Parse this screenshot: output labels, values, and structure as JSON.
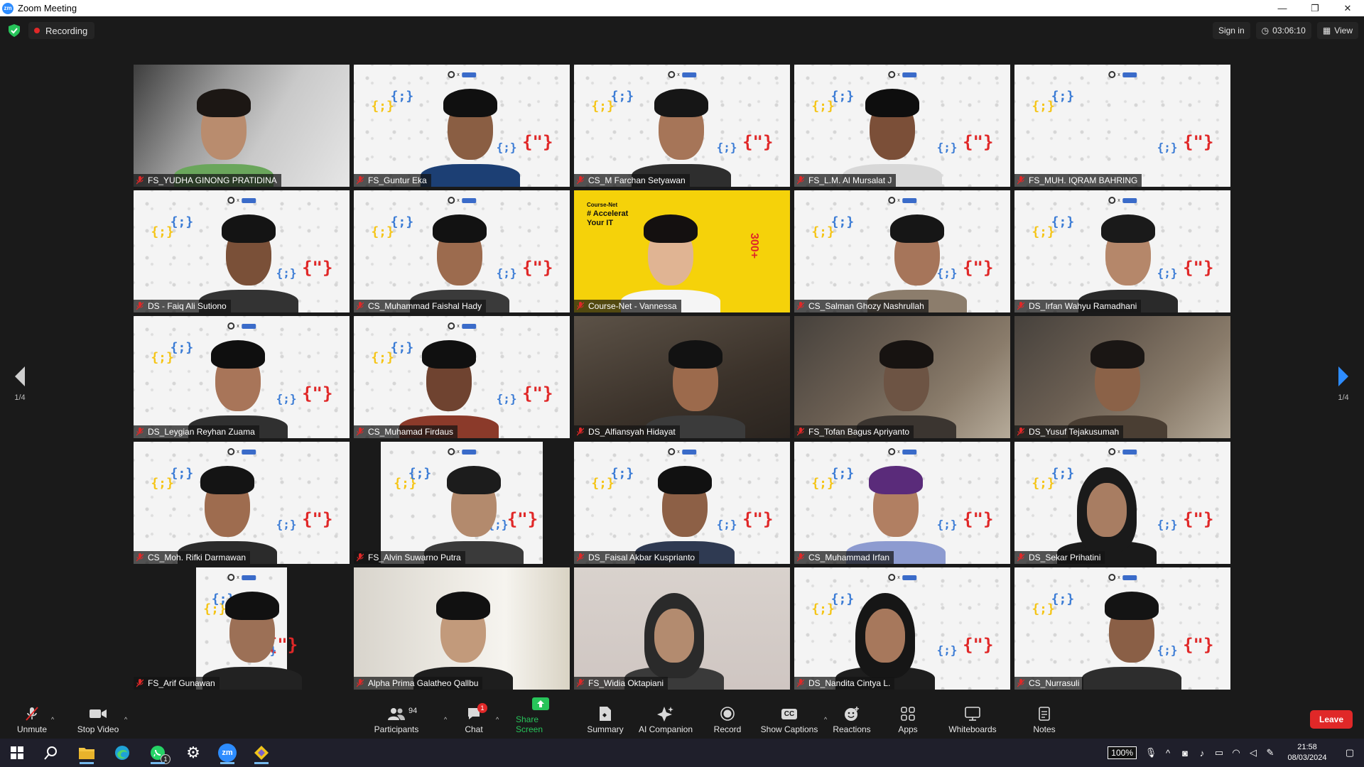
{
  "window": {
    "title": "Zoom Meeting",
    "app_icon_text": "zm",
    "minimize": "—",
    "restore": "❐",
    "close": "✕"
  },
  "meeting_bar": {
    "recording_label": "Recording",
    "sign_in": "Sign in",
    "timer": "03:06:10",
    "view_label": "View"
  },
  "pager": {
    "left_text": "1/4",
    "right_text": "1/4"
  },
  "participants": [
    {
      "name": "FS_YUDHA GINONG PRATIDINA",
      "bg": "grayroom",
      "skin": "#b98c6e",
      "hair": "#1c1714",
      "shirt": "#6aa65b"
    },
    {
      "name": "FS_Guntur Eka",
      "bg": "pattern",
      "skin": "#8a5e43",
      "hair": "#101010",
      "shirt": "#1c3f74"
    },
    {
      "name": "CS_M Farchan Setyawan",
      "bg": "pattern",
      "skin": "#a67558",
      "hair": "#161616",
      "shirt": "#2e2e2e"
    },
    {
      "name": "FS_L.M. Al Mursalat J",
      "bg": "pattern",
      "skin": "#7b4f38",
      "hair": "#0e0e0e",
      "shirt": "#d8d8d8"
    },
    {
      "name": "FS_MUH. IQRAM BAHRING",
      "bg": "pattern",
      "skin": "#000000",
      "hair": "#000000",
      "shirt": "#000000",
      "empty": true
    },
    {
      "name": "DS - Faiq Ali Sutiono",
      "bg": "pattern",
      "skin": "#7a5038",
      "hair": "#141414",
      "shirt": "#333333"
    },
    {
      "name": "CS_Muhammad Faishal Hady",
      "bg": "pattern",
      "skin": "#9c6b4e",
      "hair": "#121212",
      "shirt": "#3a3a3a"
    },
    {
      "name": "Course-Net - Vannessa",
      "bg": "yellow",
      "skin": "#e0b493",
      "hair": "#141010",
      "shirt": "#f5f5f5",
      "speaking": true
    },
    {
      "name": "CS_Salman Ghozy Nashrullah",
      "bg": "pattern",
      "skin": "#a6755a",
      "hair": "#161616",
      "shirt": "#8c7d6c"
    },
    {
      "name": "DS_Irfan Wahyu Ramadhani",
      "bg": "pattern",
      "skin": "#b5876a",
      "hair": "#1a1a1a",
      "shirt": "#2a2a2a"
    },
    {
      "name": "DS_Leygian Reyhan Zuama",
      "bg": "pattern",
      "skin": "#a87559",
      "hair": "#0f0f0f",
      "shirt": "#303030"
    },
    {
      "name": "CS_Muhamad Firdaus",
      "bg": "pattern",
      "skin": "#6f4330",
      "hair": "#101010",
      "shirt": "#8b3a2a"
    },
    {
      "name": "DS_Alfiansyah Hidayat",
      "bg": "darkroom",
      "skin": "#9c6a4c",
      "hair": "#121212",
      "shirt": "#3b3b3b"
    },
    {
      "name": "FS_Tofan Bagus Apriyanto",
      "bg": "roomwarm",
      "skin": "#6d5444",
      "hair": "#171311",
      "shirt": "#3b3530"
    },
    {
      "name": "DS_Yusuf Tejakusumah",
      "bg": "roomwarm",
      "skin": "#8b6248",
      "hair": "#1a1614",
      "shirt": "#4a3e33"
    },
    {
      "name": "CS_Moh. Rifki Darmawan",
      "bg": "pattern",
      "skin": "#9e6c4f",
      "hair": "#141414",
      "shirt": "#2b2b2b"
    },
    {
      "name": "FS_Alvin Suwarno Putra",
      "bg": "black",
      "skin": "#b38a6d",
      "hair": "#1c1c1c",
      "shirt": "#3a3a3a",
      "inset": true
    },
    {
      "name": "DS_Faisal Akbar Kusprianto",
      "bg": "pattern",
      "skin": "#8d6046",
      "hair": "#111111",
      "shirt": "#2f3a52"
    },
    {
      "name": "CS_Muhammad Irfan",
      "bg": "pattern",
      "skin": "#b17f62",
      "hair": "#5a2b7a",
      "shirt": "#8d9bd0"
    },
    {
      "name": "DS_Sekar Prihatini",
      "bg": "pattern",
      "skin": "#a87d62",
      "hair": "#1a1a1a",
      "shirt": "#1a1a1a",
      "hijab": true
    },
    {
      "name": "FS_Arif Gunawan",
      "bg": "black",
      "skin": "#9c7056",
      "hair": "#111111",
      "shirt": "#222222",
      "inset": true
    },
    {
      "name": "Alpha Prima Galatheo Qallbu",
      "bg": "interior",
      "skin": "#c29a7b",
      "hair": "#111111",
      "shirt": "#1e1e1e"
    },
    {
      "name": "FS_Widia Oktapiani",
      "bg": "wall",
      "skin": "#b38b6f",
      "hair": "#2a2a2a",
      "shirt": "#3a3a3a",
      "hijab": true
    },
    {
      "name": "DS_Nandita Cintya L.",
      "bg": "pattern",
      "skin": "#a7785c",
      "hair": "#161616",
      "shirt": "#1e1e1e",
      "hijab": true
    },
    {
      "name": "CS_Nurrasuli",
      "bg": "pattern",
      "skin": "#8a5f46",
      "hair": "#141414",
      "shirt": "#2d2d2d"
    }
  ],
  "toolbar": {
    "unmute": "Unmute",
    "stop_video": "Stop Video",
    "participants": "Participants",
    "participants_count": "94",
    "chat": "Chat",
    "chat_badge": "1",
    "share_screen": "Share Screen",
    "summary": "Summary",
    "ai_companion": "AI Companion",
    "record": "Record",
    "show_captions": "Show Captions",
    "captions_icon_text": "CC",
    "reactions": "Reactions",
    "apps": "Apps",
    "whiteboards": "Whiteboards",
    "notes": "Notes",
    "leave": "Leave"
  },
  "vannessa_banner": {
    "line1": "Accelerat",
    "line2": "Your IT",
    "side": "300+",
    "brand": "Course-Net"
  },
  "taskbar": {
    "zoom_label": "zm",
    "whatsapp_badge": "1",
    "zoom_percent": "100%",
    "time": "21:58",
    "date": "08/03/2024"
  },
  "colors": {
    "accent_green": "#27c45a",
    "leave_red": "#e02828",
    "zoom_blue": "#2d8cff",
    "speaker_yellow": "#f5d20a"
  }
}
